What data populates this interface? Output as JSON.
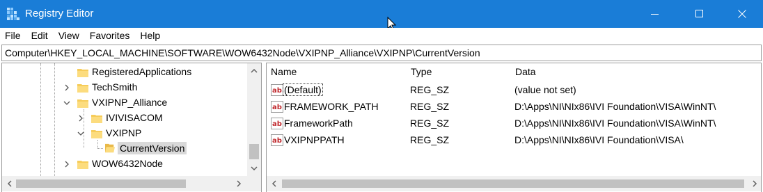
{
  "window": {
    "title": "Registry Editor",
    "accent_color": "#1a7dd7",
    "icon": "registry-editor-icon"
  },
  "menu": {
    "items": [
      "File",
      "Edit",
      "View",
      "Favorites",
      "Help"
    ]
  },
  "address": {
    "path": "Computer\\HKEY_LOCAL_MACHINE\\SOFTWARE\\WOW6432Node\\VXIPNP_Alliance\\VXIPNP\\CurrentVersion"
  },
  "tree": {
    "items": [
      {
        "label": "RegisteredApplications",
        "expander": "none",
        "selected": false
      },
      {
        "label": "TechSmith",
        "expander": "collapsed",
        "selected": false
      },
      {
        "label": "VXIPNP_Alliance",
        "expander": "expanded",
        "selected": false
      },
      {
        "label": "IVIVISACOM",
        "expander": "collapsed",
        "selected": false
      },
      {
        "label": "VXIPNP",
        "expander": "expanded",
        "selected": false
      },
      {
        "label": "CurrentVersion",
        "expander": "none",
        "selected": true
      },
      {
        "label": "WOW6432Node",
        "expander": "collapsed",
        "selected": false
      }
    ]
  },
  "values": {
    "columns": {
      "name": "Name",
      "type": "Type",
      "data": "Data"
    },
    "rows": [
      {
        "name": "(Default)",
        "type": "REG_SZ",
        "data": "(value not set)"
      },
      {
        "name": "FRAMEWORK_PATH",
        "type": "REG_SZ",
        "data": "D:\\Apps\\NI\\NIx86\\IVI Foundation\\VISA\\WinNT\\"
      },
      {
        "name": "FrameworkPath",
        "type": "REG_SZ",
        "data": "D:\\Apps\\NI\\NIx86\\IVI Foundation\\VISA\\WinNT\\"
      },
      {
        "name": "VXIPNPPATH",
        "type": "REG_SZ",
        "data": "D:\\Apps\\NI\\NIx86\\IVI Foundation\\VISA\\"
      }
    ]
  }
}
